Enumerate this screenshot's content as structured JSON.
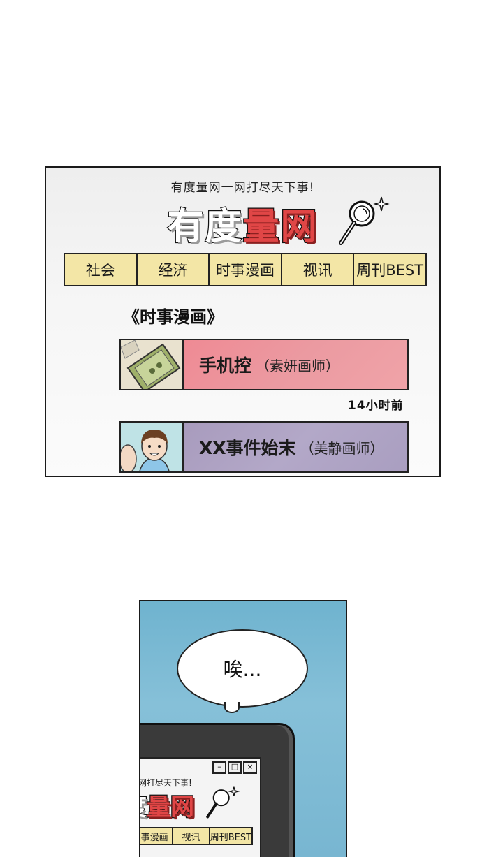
{
  "panel1": {
    "tagline": "有度量网一网打尽天下事!",
    "logo": {
      "part_a": "有度",
      "part_b": "量网"
    },
    "nav": [
      "社会",
      "经济",
      "时事漫画",
      "视讯",
      "周刊BEST"
    ],
    "section_title": "《时事漫画》",
    "cards": [
      {
        "title": "手机控",
        "author": "（素妍画师）"
      },
      {
        "title": "XX事件始末",
        "author": "（美静画师）"
      }
    ],
    "timestamp": "14小时前"
  },
  "panel2": {
    "bubble_text": "唉...",
    "window_controls": [
      "–",
      "□",
      "×"
    ],
    "mini_tagline": "网打尽天下事!",
    "mini_logo": {
      "part_a": "度",
      "part_b": "量网"
    },
    "mini_nav": [
      "事漫画",
      "视讯",
      "周刊BEST"
    ]
  },
  "colors": {
    "nav_bg": "#f3e6a6",
    "logo_red": "#e04646",
    "card1_bg": "#ef8a94",
    "card2_bg": "#b3a8c8",
    "panel2_bg": "#7fb9d3"
  }
}
